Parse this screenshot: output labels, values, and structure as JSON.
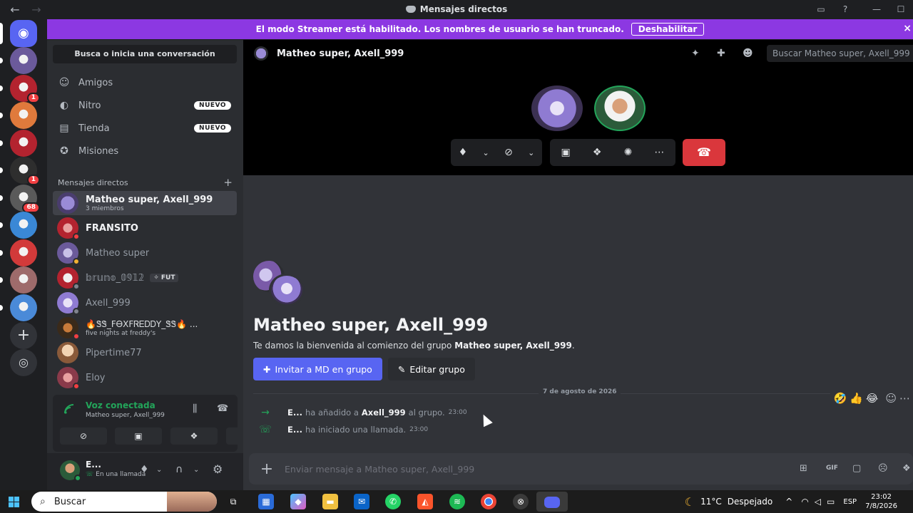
{
  "window": {
    "title": "Mensajes directos",
    "back_icon": "arrow-left-icon",
    "forward_icon": "arrow-right-icon"
  },
  "banner": {
    "text": "El modo Streamer está habilitado. Los nombres de usuario se han truncado.",
    "button": "Deshabilitar",
    "close": "×",
    "color": "#8c38e2"
  },
  "servers": [
    {
      "badge": "",
      "color": "#5865f2"
    },
    {
      "badge": "",
      "color": "#6b5a9b"
    },
    {
      "badge": "1",
      "color": "#b3232f"
    },
    {
      "badge": "",
      "color": "#e07a3c"
    },
    {
      "badge": "",
      "color": "#b3232f"
    },
    {
      "badge": "1",
      "color": "#2e2e2e"
    },
    {
      "badge": "68",
      "color": "#5a5a5a"
    },
    {
      "badge": "",
      "color": "#3a88d6"
    },
    {
      "badge": "",
      "color": "#d23a3a"
    },
    {
      "badge": "",
      "color": "#9e6b6b"
    },
    {
      "badge": "",
      "color": "#4a8ad8"
    }
  ],
  "sidebar": {
    "search_label": "Busca o inicia una conversación",
    "nav": [
      {
        "label": "Amigos",
        "pill": ""
      },
      {
        "label": "Nitro",
        "pill": "NUEVO"
      },
      {
        "label": "Tienda",
        "pill": "NUEVO"
      },
      {
        "label": "Misiones",
        "pill": ""
      }
    ],
    "dm_header": "Mensajes directos",
    "dm_add": "+",
    "dms": [
      {
        "name": "Matheo super, Axell_999",
        "sub": "3 miembros",
        "tag": ""
      },
      {
        "name": "FRANSITO",
        "sub": "",
        "tag": ""
      },
      {
        "name": "Matheo super",
        "sub": "",
        "tag": ""
      },
      {
        "name": "𝕓𝕣𝕦𝕟𝕠_𝟘𝟡𝟙𝟚",
        "sub": "",
        "tag": "✧ FUT"
      },
      {
        "name": "Axell_999",
        "sub": "",
        "tag": ""
      },
      {
        "name": "🔥ᏕᏕ_FᎾXFᏒᎬᎠᎠY_ᏕᏕ🔥 ...",
        "sub": "five nights at freddy's",
        "tag": ""
      },
      {
        "name": "Pipertime77",
        "sub": "",
        "tag": ""
      },
      {
        "name": "Eloy",
        "sub": "",
        "tag": ""
      }
    ]
  },
  "voice": {
    "status": "Voz conectada",
    "channel": "Matheo super, Axell_999"
  },
  "user": {
    "name": "E...",
    "status": "En una llamada"
  },
  "main": {
    "header_title": "Matheo super, Axell_999",
    "search_placeholder": "Buscar Matheo super, Axell_999",
    "welcome_title": "Matheo super, Axell_999",
    "welcome_text_pre": "Te damos la bienvenida al comienzo del grupo ",
    "welcome_text_bold": "Matheo super, Axell_999",
    "welcome_text_post": ".",
    "invite_button": "Invitar a MD en grupo",
    "edit_button": "Editar grupo",
    "date_divider": "7 de agosto de 2026",
    "messages": [
      {
        "actor": "E...",
        "text": "ha añadido a",
        "target": "Axell_999",
        "suffix": "al grupo.",
        "time": "23:00",
        "icon": "arrow-right-icon"
      },
      {
        "actor": "E...",
        "text": "ha iniciado una llamada.",
        "target": "",
        "suffix": "",
        "time": "23:00",
        "icon": "phone-icon"
      }
    ],
    "composer_placeholder": "Enviar mensaje a Matheo super, Axell_999"
  },
  "taskbar": {
    "search": "Buscar",
    "weather_temp": "11°C",
    "weather_desc": "Despejado",
    "lang": "ESP",
    "time": "23:02",
    "date": "7/8/2026"
  }
}
